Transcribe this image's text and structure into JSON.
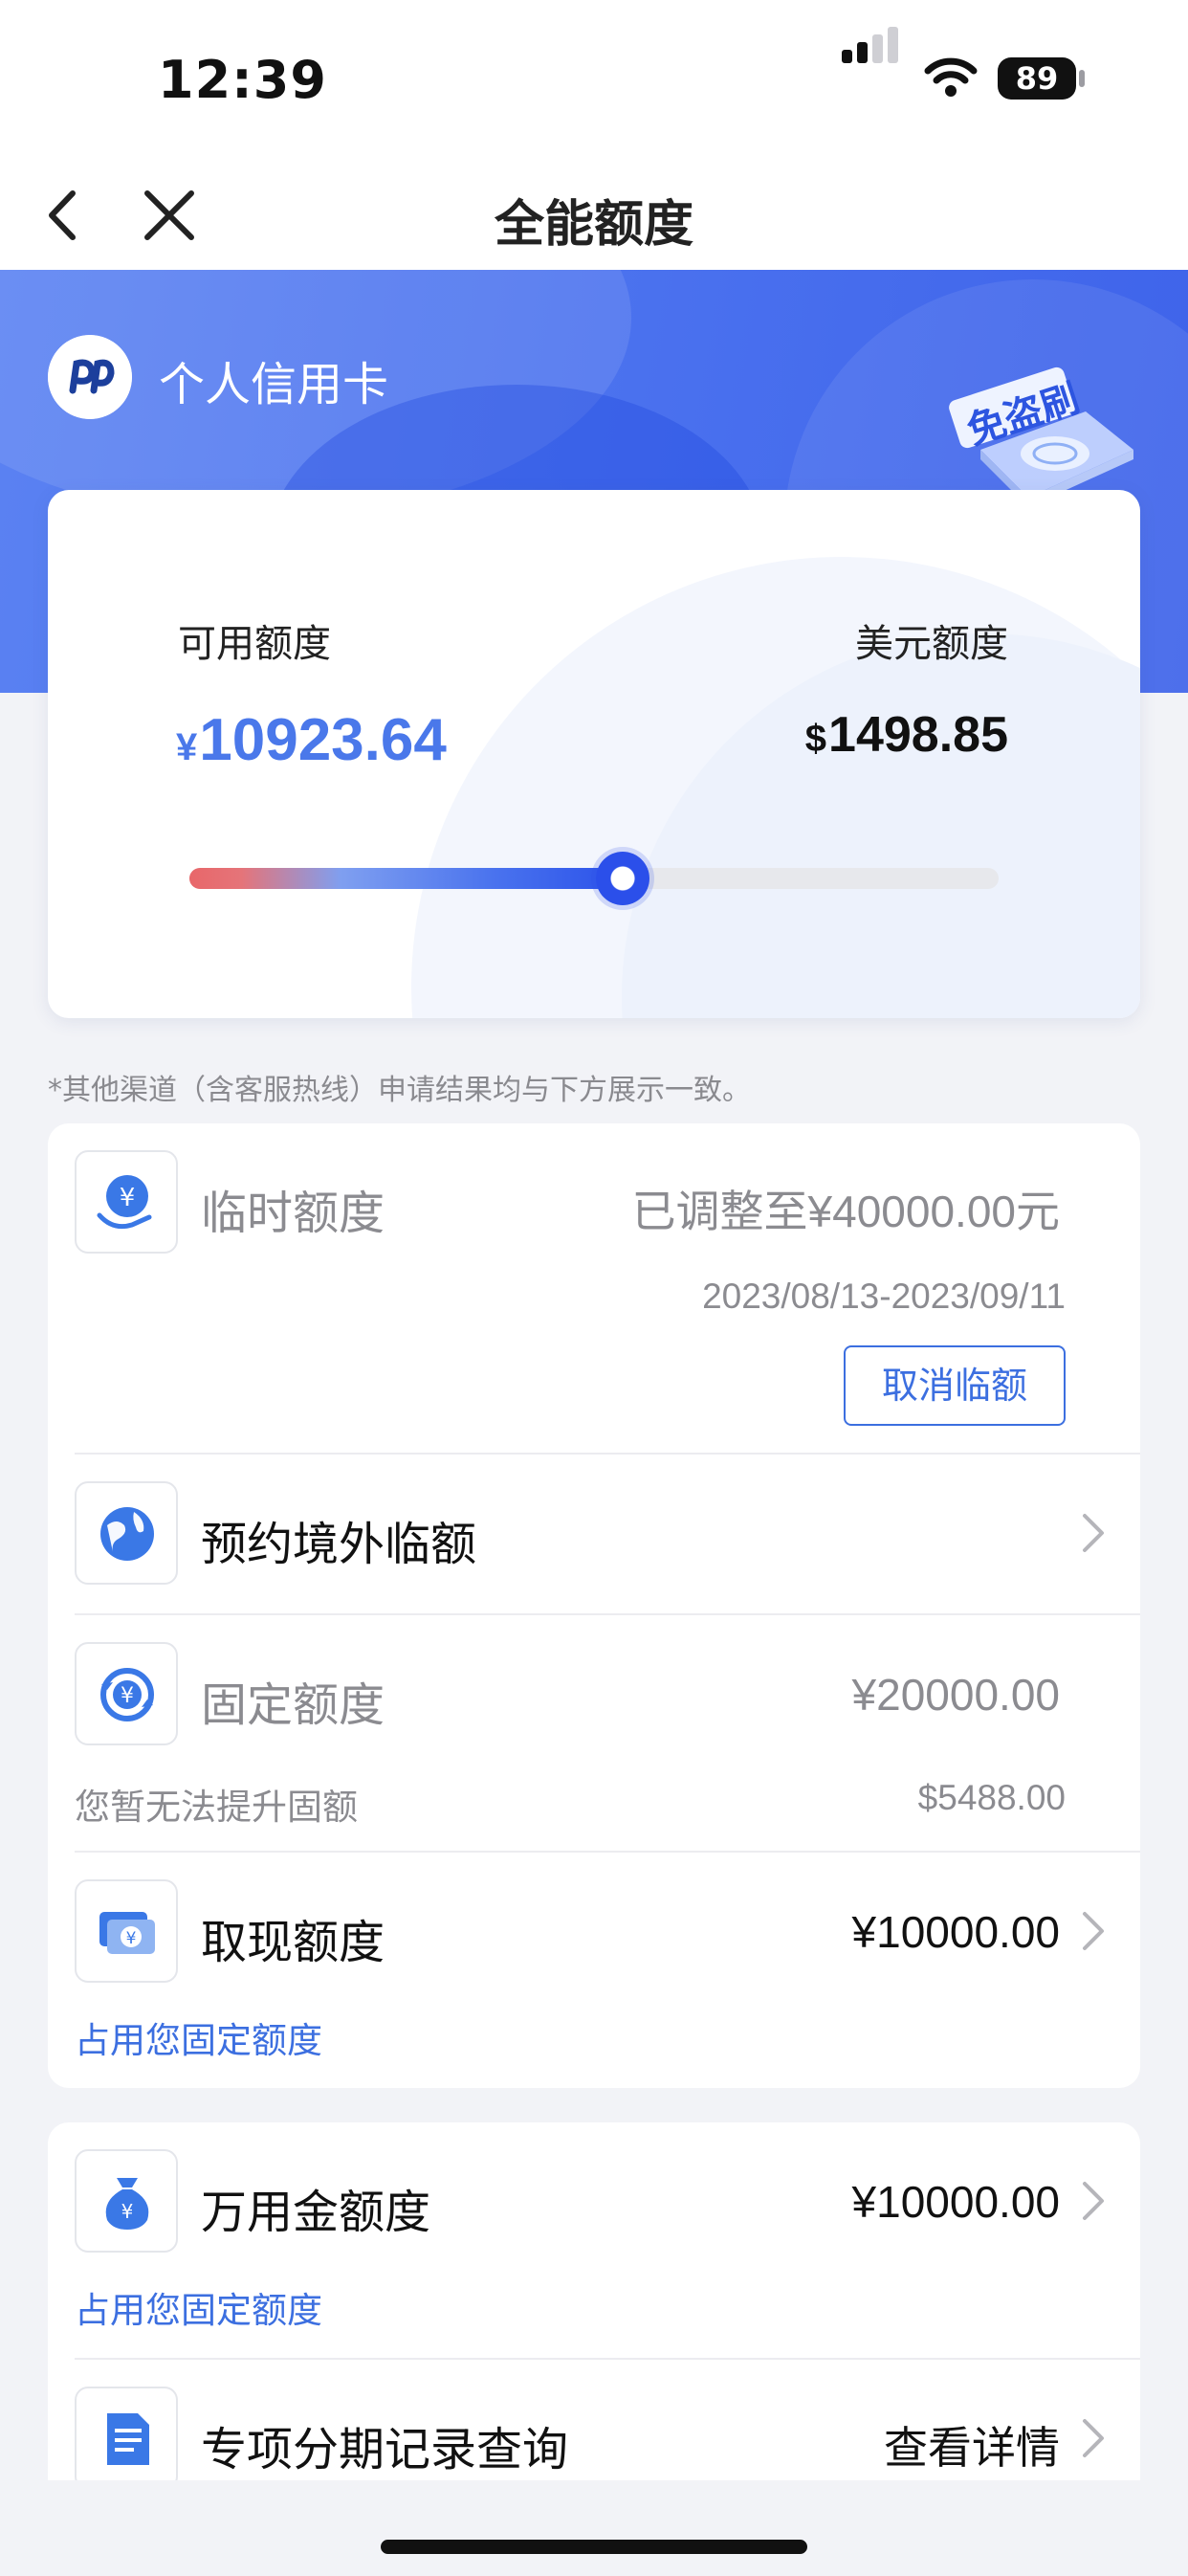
{
  "status_bar": {
    "time": "12:39",
    "battery": "89"
  },
  "nav": {
    "title": "全能额度",
    "back_icon": "chevron-left-icon",
    "close_icon": "close-icon"
  },
  "card_brand": {
    "name": "个人信用卡",
    "badge_icon": "anti-theft-badge-icon"
  },
  "summary": {
    "available_label": "可用额度",
    "available_currency": "¥",
    "available_amount": "10923.64",
    "usd_label": "美元额度",
    "usd_currency": "$",
    "usd_amount": "1498.85",
    "usage_fraction": 0.535
  },
  "notice": "*其他渠道（含客服热线）申请结果均与下方展示一致。",
  "limits": {
    "temporary": {
      "label": "临时额度",
      "value": "已调整至¥40000.00元",
      "period": "2023/08/13-2023/09/11",
      "cancel_button": "取消临额"
    },
    "overseas": {
      "label": "预约境外临额"
    },
    "fixed": {
      "label": "固定额度",
      "value": "¥20000.00",
      "note": "您暂无法提升固额",
      "usd_value": "$5488.00"
    },
    "cash": {
      "label": "取现额度",
      "value": "¥10000.00",
      "note": "占用您固定额度"
    }
  },
  "extras": {
    "wanyongjin": {
      "label": "万用金额度",
      "value": "¥10000.00",
      "note": "占用您固定额度"
    },
    "installment": {
      "label": "专项分期记录查询",
      "value": "查看详情"
    }
  },
  "colors": {
    "brand_blue": "#4a78ea",
    "link_blue": "#3c6fe0",
    "muted_gray": "#8b8b90"
  }
}
